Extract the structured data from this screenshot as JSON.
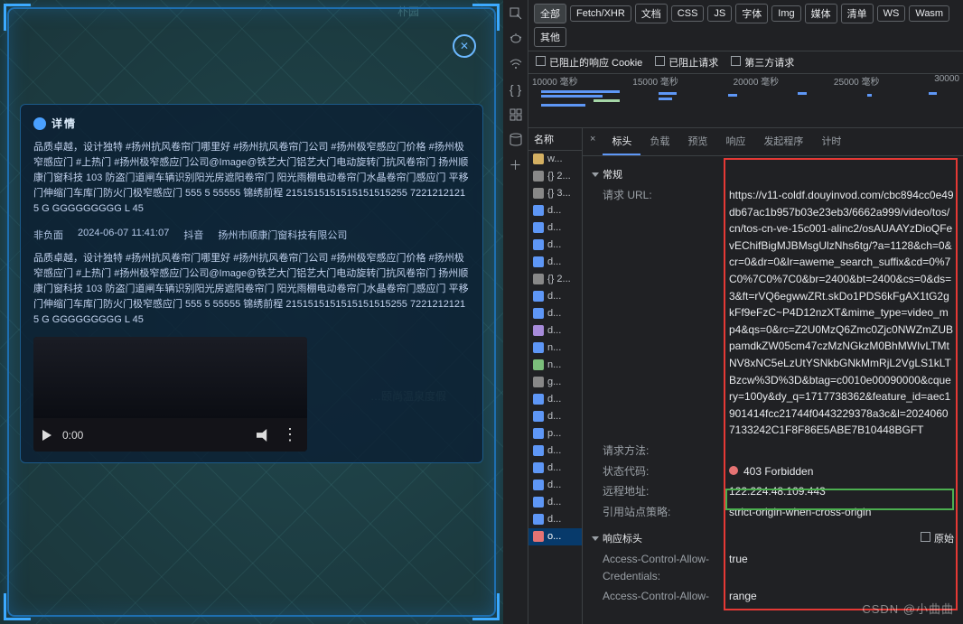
{
  "left": {
    "close": "✕",
    "title": "详情",
    "paragraph1": "品质卓越，设计独特 #扬州抗风卷帘门哪里好 #扬州抗风卷帘门公司 #扬州极窄感应门价格 #扬州极窄感应门 #上热门 #扬州极窄感应门公司@Image@铁艺大门铝艺大门电动旋转门抗风卷帘门 扬州顺康门窗科技 103 防盗门道闸车辆识别阳光房遮阳卷帘门 阳光雨棚电动卷帘门水晶卷帘门感应门 平移门伸缩门车库门防火门极窄感应门 555 5 55555 锦绣前程 2151515151515151515255 72212121215 G GGGGGGGGG L 45",
    "meta": {
      "type": "非负面",
      "time": "2024-06-07 11:41:07",
      "source": "抖音",
      "org": "扬州市顺康门窗科技有限公司"
    },
    "paragraph2": "品质卓越，设计独特 #扬州抗风卷帘门哪里好 #扬州抗风卷帘门公司 #扬州极窄感应门价格 #扬州极窄感应门 #上热门 #扬州极窄感应门公司@Image@铁艺大门铝艺大门电动旋转门抗风卷帘门 扬州顺康门窗科技 103 防盗门道闸车辆识别阳光房遮阳卷帘门 阳光雨棚电动卷帘门水晶卷帘门感应门 平移门伸缩门车库门防火门极窄感应门 555 5 55555 锦绣前程 2151515151515151515255 72212121215 G GGGGGGGGG L 45",
    "video_time": "0:00",
    "more": "⋮",
    "map_labels": [
      "朴园",
      "…颐尚温泉度假"
    ]
  },
  "dev": {
    "filters": [
      "全部",
      "Fetch/XHR",
      "文档",
      "CSS",
      "JS",
      "字体",
      "Img",
      "媒体",
      "清单",
      "WS",
      "Wasm",
      "其他"
    ],
    "opts": {
      "blocked_cookie": "已阻止的响应 Cookie",
      "blocked_req": "已阻止请求",
      "third": "第三方请求"
    },
    "ticks": [
      "10000 毫秒",
      "15000 毫秒",
      "20000 毫秒",
      "25000 毫秒",
      "30000"
    ],
    "name_header": "名称",
    "requests": [
      {
        "ic": "js",
        "t": "w..."
      },
      {
        "ic": "xhr",
        "t": "{} 2..."
      },
      {
        "ic": "xhr",
        "t": "{} 3..."
      },
      {
        "ic": "doc",
        "t": "d..."
      },
      {
        "ic": "doc",
        "t": "d..."
      },
      {
        "ic": "doc",
        "t": "d..."
      },
      {
        "ic": "doc",
        "t": "d..."
      },
      {
        "ic": "xhr",
        "t": "{} 2..."
      },
      {
        "ic": "doc",
        "t": "d..."
      },
      {
        "ic": "doc",
        "t": "d..."
      },
      {
        "ic": "css",
        "t": "d..."
      },
      {
        "ic": "doc",
        "t": "n..."
      },
      {
        "ic": "img",
        "t": "n..."
      },
      {
        "ic": "xhr",
        "t": "g..."
      },
      {
        "ic": "doc",
        "t": "d..."
      },
      {
        "ic": "doc",
        "t": "d..."
      },
      {
        "ic": "doc",
        "t": "p..."
      },
      {
        "ic": "doc",
        "t": "d..."
      },
      {
        "ic": "doc",
        "t": "d..."
      },
      {
        "ic": "doc",
        "t": "d..."
      },
      {
        "ic": "doc",
        "t": "d..."
      },
      {
        "ic": "doc",
        "t": "d..."
      },
      {
        "ic": "red",
        "t": "o..."
      }
    ],
    "tabs2": [
      "标头",
      "负载",
      "预览",
      "响应",
      "发起程序",
      "计时"
    ],
    "tabs2_x": "×",
    "general_heading": "常规",
    "url_label": "请求 URL:",
    "url": "https://v11-coldf.douyinvod.com/cbc894cc0e49db67ac1b957b03e23eb3/6662a999/video/tos/cn/tos-cn-ve-15c001-alinc2/osAUAAYzDioQFevEChifBigMJBMsgUlzNhs6tg/?a=1128&ch=0&cr=0&dr=0&lr=aweme_search_suffix&cd=0%7C0%7C0%7C0&br=2400&bt=2400&cs=0&ds=3&ft=rVQ6egwwZRt.skDo1PDS6kFgAX1tG2gkFf9eFzC~P4D12nzXT&mime_type=video_mp4&qs=0&rc=Z2U0MzQ6Zmc0Zjc0NWZmZUBpamdkZW05cm47czMzNGkzM0BhMWIvLTMtNV8xNC5eLzUtYSNkbGNkMmRjL2VgLS1kLTBzcw%3D%3D&btag=c0010e00090000&cquery=100y&dy_q=1717738362&feature_id=aec1901414fcc21744f0443229378a3c&l=20240607133242C1F8F86E5ABE7B10448BGFT",
    "method_label": "请求方法:",
    "status_label": "状态代码:",
    "status": "403 Forbidden",
    "remote_label": "远程地址:",
    "remote": "122.224.48.109:443",
    "referrer_label": "引用站点策略:",
    "referrer": "strict-origin-when-cross-origin",
    "resp_heading": "响应标头",
    "raw": "原始",
    "resp_headers": [
      {
        "k": "Access-Control-Allow-Credentials:",
        "v": "true"
      },
      {
        "k": "Access-Control-Allow-",
        "v": "range"
      }
    ]
  },
  "watermark": "CSDN @小曲曲"
}
